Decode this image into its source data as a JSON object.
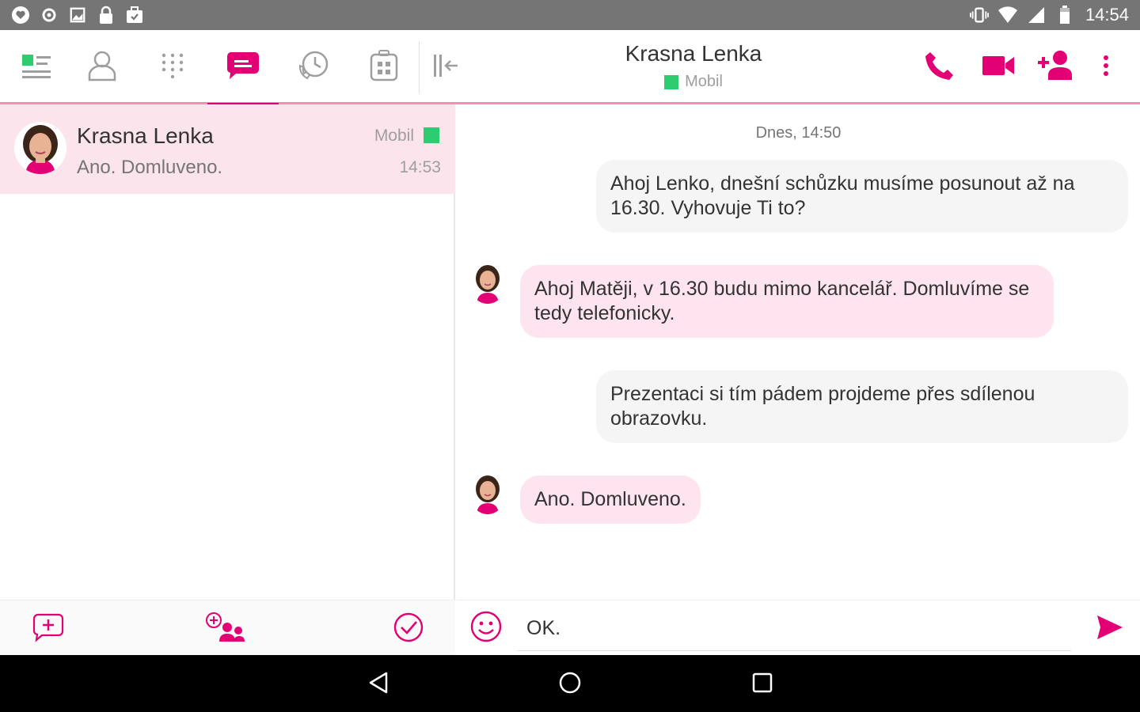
{
  "status_bar": {
    "time": "14:54",
    "left_icons": [
      "heart-notification-icon",
      "sync-icon",
      "image-icon",
      "lock-icon",
      "briefcase-icon"
    ],
    "right_icons": [
      "vibrate-icon",
      "wifi-icon",
      "signal-icon",
      "battery-icon"
    ]
  },
  "toolbar": {
    "tabs": [
      {
        "name": "status",
        "icon": "status-list-icon"
      },
      {
        "name": "contacts",
        "icon": "person-icon"
      },
      {
        "name": "dialpad",
        "icon": "dialpad-icon"
      },
      {
        "name": "messages",
        "icon": "chat-icon",
        "active": true
      },
      {
        "name": "history",
        "icon": "call-history-icon"
      },
      {
        "name": "apps",
        "icon": "apps-icon"
      }
    ],
    "collapse_icon": "collapse-panel-icon",
    "contact": {
      "name": "Krasna Lenka",
      "channel": "Mobil"
    },
    "actions": [
      "phone-icon",
      "video-icon",
      "add-person-icon",
      "more-vert-icon"
    ]
  },
  "conversations": [
    {
      "name": "Krasna Lenka",
      "last_message": "Ano. Domluveno.",
      "channel": "Mobil",
      "time": "14:53",
      "selected": true
    }
  ],
  "left_bottom": {
    "buttons": [
      "new-message-icon",
      "new-group-chat-icon",
      "select-check-icon"
    ]
  },
  "chat": {
    "date_separator": "Dnes, 14:50",
    "messages": [
      {
        "direction": "out",
        "text": "Ahoj Lenko, dnešní schůzku musíme posunout až na 16.30. Vyhovuje Ti to?"
      },
      {
        "direction": "in",
        "text": "Ahoj Matěji, v 16.30 budu mimo kancelář. Domluvíme se tedy telefonicky."
      },
      {
        "direction": "out",
        "text": "Prezentaci si tím pádem projdeme přes sdílenou obrazovku."
      },
      {
        "direction": "in",
        "text": "Ano. Domluveno."
      }
    ]
  },
  "composer": {
    "value": "OK.",
    "emoji_icon": "emoji-icon",
    "send_icon": "send-icon"
  },
  "navbar": {
    "buttons": [
      "back-icon",
      "home-icon",
      "recents-icon"
    ]
  },
  "colors": {
    "accent": "#e20074",
    "selected_row": "#fce4ec",
    "incoming_bubble": "#fde4ee",
    "outgoing_bubble": "#f5f5f5",
    "status_bar": "#757575",
    "online": "#2ecc71"
  }
}
